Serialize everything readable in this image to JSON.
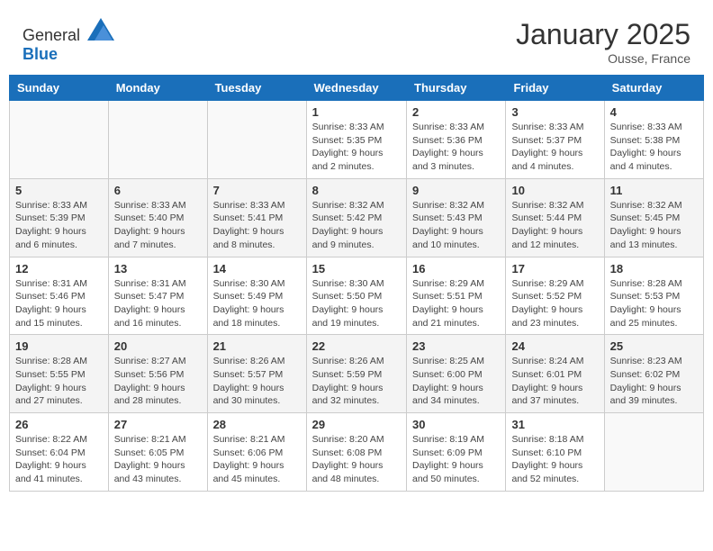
{
  "header": {
    "logo_general": "General",
    "logo_blue": "Blue",
    "month_title": "January 2025",
    "location": "Ousse, France"
  },
  "weekdays": [
    "Sunday",
    "Monday",
    "Tuesday",
    "Wednesday",
    "Thursday",
    "Friday",
    "Saturday"
  ],
  "weeks": [
    [
      {
        "day": "",
        "info": ""
      },
      {
        "day": "",
        "info": ""
      },
      {
        "day": "",
        "info": ""
      },
      {
        "day": "1",
        "info": "Sunrise: 8:33 AM\nSunset: 5:35 PM\nDaylight: 9 hours\nand 2 minutes."
      },
      {
        "day": "2",
        "info": "Sunrise: 8:33 AM\nSunset: 5:36 PM\nDaylight: 9 hours\nand 3 minutes."
      },
      {
        "day": "3",
        "info": "Sunrise: 8:33 AM\nSunset: 5:37 PM\nDaylight: 9 hours\nand 4 minutes."
      },
      {
        "day": "4",
        "info": "Sunrise: 8:33 AM\nSunset: 5:38 PM\nDaylight: 9 hours\nand 4 minutes."
      }
    ],
    [
      {
        "day": "5",
        "info": "Sunrise: 8:33 AM\nSunset: 5:39 PM\nDaylight: 9 hours\nand 6 minutes."
      },
      {
        "day": "6",
        "info": "Sunrise: 8:33 AM\nSunset: 5:40 PM\nDaylight: 9 hours\nand 7 minutes."
      },
      {
        "day": "7",
        "info": "Sunrise: 8:33 AM\nSunset: 5:41 PM\nDaylight: 9 hours\nand 8 minutes."
      },
      {
        "day": "8",
        "info": "Sunrise: 8:32 AM\nSunset: 5:42 PM\nDaylight: 9 hours\nand 9 minutes."
      },
      {
        "day": "9",
        "info": "Sunrise: 8:32 AM\nSunset: 5:43 PM\nDaylight: 9 hours\nand 10 minutes."
      },
      {
        "day": "10",
        "info": "Sunrise: 8:32 AM\nSunset: 5:44 PM\nDaylight: 9 hours\nand 12 minutes."
      },
      {
        "day": "11",
        "info": "Sunrise: 8:32 AM\nSunset: 5:45 PM\nDaylight: 9 hours\nand 13 minutes."
      }
    ],
    [
      {
        "day": "12",
        "info": "Sunrise: 8:31 AM\nSunset: 5:46 PM\nDaylight: 9 hours\nand 15 minutes."
      },
      {
        "day": "13",
        "info": "Sunrise: 8:31 AM\nSunset: 5:47 PM\nDaylight: 9 hours\nand 16 minutes."
      },
      {
        "day": "14",
        "info": "Sunrise: 8:30 AM\nSunset: 5:49 PM\nDaylight: 9 hours\nand 18 minutes."
      },
      {
        "day": "15",
        "info": "Sunrise: 8:30 AM\nSunset: 5:50 PM\nDaylight: 9 hours\nand 19 minutes."
      },
      {
        "day": "16",
        "info": "Sunrise: 8:29 AM\nSunset: 5:51 PM\nDaylight: 9 hours\nand 21 minutes."
      },
      {
        "day": "17",
        "info": "Sunrise: 8:29 AM\nSunset: 5:52 PM\nDaylight: 9 hours\nand 23 minutes."
      },
      {
        "day": "18",
        "info": "Sunrise: 8:28 AM\nSunset: 5:53 PM\nDaylight: 9 hours\nand 25 minutes."
      }
    ],
    [
      {
        "day": "19",
        "info": "Sunrise: 8:28 AM\nSunset: 5:55 PM\nDaylight: 9 hours\nand 27 minutes."
      },
      {
        "day": "20",
        "info": "Sunrise: 8:27 AM\nSunset: 5:56 PM\nDaylight: 9 hours\nand 28 minutes."
      },
      {
        "day": "21",
        "info": "Sunrise: 8:26 AM\nSunset: 5:57 PM\nDaylight: 9 hours\nand 30 minutes."
      },
      {
        "day": "22",
        "info": "Sunrise: 8:26 AM\nSunset: 5:59 PM\nDaylight: 9 hours\nand 32 minutes."
      },
      {
        "day": "23",
        "info": "Sunrise: 8:25 AM\nSunset: 6:00 PM\nDaylight: 9 hours\nand 34 minutes."
      },
      {
        "day": "24",
        "info": "Sunrise: 8:24 AM\nSunset: 6:01 PM\nDaylight: 9 hours\nand 37 minutes."
      },
      {
        "day": "25",
        "info": "Sunrise: 8:23 AM\nSunset: 6:02 PM\nDaylight: 9 hours\nand 39 minutes."
      }
    ],
    [
      {
        "day": "26",
        "info": "Sunrise: 8:22 AM\nSunset: 6:04 PM\nDaylight: 9 hours\nand 41 minutes."
      },
      {
        "day": "27",
        "info": "Sunrise: 8:21 AM\nSunset: 6:05 PM\nDaylight: 9 hours\nand 43 minutes."
      },
      {
        "day": "28",
        "info": "Sunrise: 8:21 AM\nSunset: 6:06 PM\nDaylight: 9 hours\nand 45 minutes."
      },
      {
        "day": "29",
        "info": "Sunrise: 8:20 AM\nSunset: 6:08 PM\nDaylight: 9 hours\nand 48 minutes."
      },
      {
        "day": "30",
        "info": "Sunrise: 8:19 AM\nSunset: 6:09 PM\nDaylight: 9 hours\nand 50 minutes."
      },
      {
        "day": "31",
        "info": "Sunrise: 8:18 AM\nSunset: 6:10 PM\nDaylight: 9 hours\nand 52 minutes."
      },
      {
        "day": "",
        "info": ""
      }
    ]
  ]
}
